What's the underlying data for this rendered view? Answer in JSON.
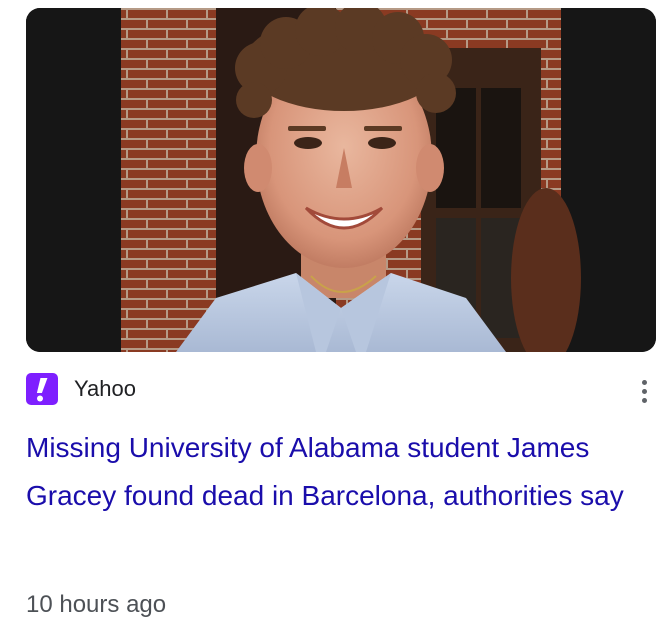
{
  "article": {
    "image_alt": "Photo of a smiling young man with curly hair",
    "source": {
      "name": "Yahoo",
      "logo_icon": "yahoo-logo-icon",
      "logo_color": "#7e1fff"
    },
    "menu_icon": "more-vert-icon",
    "headline": "Missing University of Alabama student James Gracey found dead in Barcelona, authorities say",
    "timestamp": "10 hours ago"
  },
  "colors": {
    "headline": "#1a0dab",
    "source_text": "#202124",
    "timestamp": "#4d5156"
  }
}
